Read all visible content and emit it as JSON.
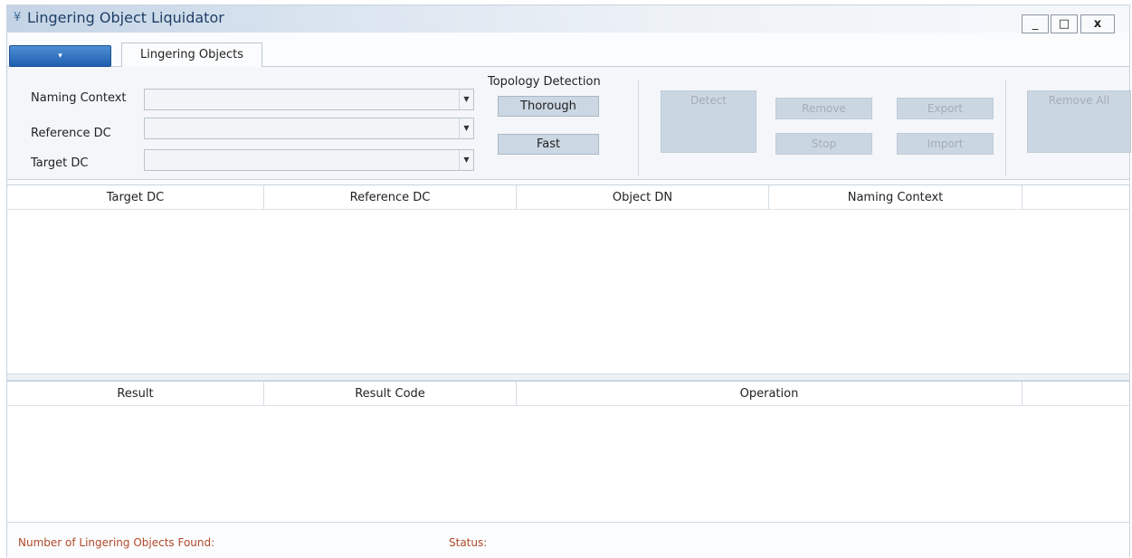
{
  "window": {
    "title": "Lingering Object Liquidator",
    "app_icon": "¥",
    "minimize": "_",
    "maximize": "□",
    "close": "x"
  },
  "ribbon": {
    "app_menu_arrow": "▾",
    "tabs": [
      {
        "label": "Lingering Objects",
        "selected": true
      }
    ],
    "fields": {
      "naming_context_label": "Naming Context",
      "naming_context_value": "",
      "reference_dc_label": "Reference DC",
      "reference_dc_value": "",
      "target_dc_label": "Target DC",
      "target_dc_value": ""
    },
    "topology": {
      "group_label": "Topology Detection",
      "thorough_label": "Thorough",
      "fast_label": "Fast"
    },
    "actions": {
      "detect_label": "Detect",
      "remove_label": "Remove",
      "stop_label": "Stop",
      "export_label": "Export",
      "import_label": "Import",
      "remove_all_label": "Remove All"
    }
  },
  "objects_grid": {
    "columns": [
      "Target DC",
      "Reference DC",
      "Object DN",
      "Naming Context"
    ]
  },
  "results_grid": {
    "columns": [
      "Result",
      "Result Code",
      "Operation"
    ]
  },
  "status_bar": {
    "count_label": "Number of Lingering Objects Found:",
    "status_label": "Status:"
  },
  "colors": {
    "status_text": "#b14a2a",
    "app_menu_blue": "#2a6cbf",
    "disabled_button": "#cad6e2"
  }
}
